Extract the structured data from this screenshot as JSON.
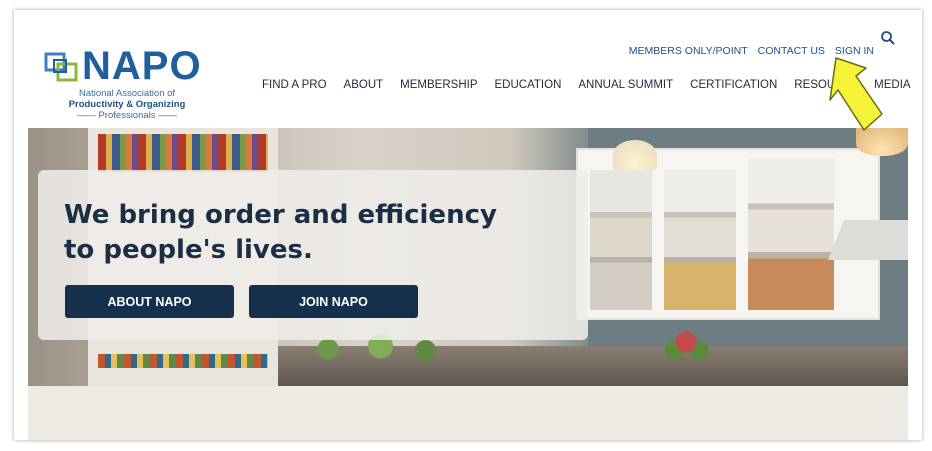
{
  "logo": {
    "wordmark": "NAPO",
    "line1": "National Association of",
    "line2": "Productivity & Organizing",
    "line3": "—— Professionals ——"
  },
  "utility_nav": [
    "MEMBERS ONLY/POINT",
    "CONTACT US",
    "SIGN IN"
  ],
  "main_nav": [
    "FIND A PRO",
    "ABOUT",
    "MEMBERSHIP",
    "EDUCATION",
    "ANNUAL SUMMIT",
    "CERTIFICATION",
    "RESOU",
    "MEDIA"
  ],
  "hero": {
    "headline_1": "We bring order and efficiency",
    "headline_2": "to people's lives.",
    "button_about": "ABOUT NAPO",
    "button_join": "JOIN NAPO"
  },
  "colors": {
    "brand": "#1f5f9e",
    "button": "#14304d",
    "arrow": "#f5f23a"
  },
  "icons": {
    "search": "search-icon",
    "annotation": "yellow-arrow-annotation"
  }
}
